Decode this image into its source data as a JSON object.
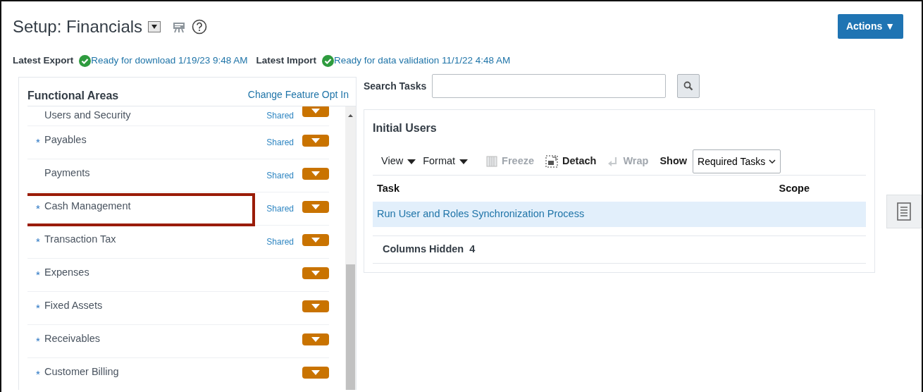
{
  "page": {
    "title": "Setup: Financials"
  },
  "actions_button": {
    "label": "Actions ▼"
  },
  "status": [
    {
      "label": "Latest Export",
      "value": "Ready for download 1/19/23 9:48 AM"
    },
    {
      "label": "Latest Import",
      "value": "Ready for data validation 11/1/22 4:48 AM"
    }
  ],
  "functional_areas": {
    "title": "Functional Areas",
    "link": "Change Feature Opt In",
    "items": [
      {
        "name": "Users and Security",
        "shared": "Shared",
        "highlighted": false
      },
      {
        "marker": "*",
        "name": "Payables",
        "shared": "Shared",
        "highlighted": false
      },
      {
        "name": "Payments",
        "shared": "Shared",
        "highlighted": false
      },
      {
        "marker": "*",
        "name": "Cash Management",
        "shared": "Shared",
        "highlighted": true
      },
      {
        "marker": "*",
        "name": "Transaction Tax",
        "shared": "Shared",
        "highlighted": false
      },
      {
        "marker": "*",
        "name": "Expenses",
        "highlighted": false
      },
      {
        "marker": "*",
        "name": "Fixed Assets",
        "highlighted": false
      },
      {
        "marker": "*",
        "name": "Receivables",
        "highlighted": false
      },
      {
        "marker": "*",
        "name": "Customer Billing",
        "highlighted": false
      }
    ]
  },
  "search": {
    "label": "Search Tasks"
  },
  "task_panel": {
    "title": "Initial Users",
    "toolbar": [
      {
        "kind": "menu",
        "label": "View",
        "disabled": false
      },
      {
        "kind": "menu",
        "label": "Format",
        "disabled": false
      },
      {
        "kind": "freeze",
        "label": "Freeze",
        "disabled": true
      },
      {
        "kind": "detach",
        "label": "Detach",
        "disabled": false
      },
      {
        "kind": "wrap",
        "label": "Wrap",
        "disabled": true
      }
    ],
    "show": {
      "label": "Show",
      "value": "Required Tasks"
    },
    "columns": [
      "Task",
      "Scope"
    ],
    "rows": [
      {
        "task": "Run User and Roles Synchronization Process",
        "selected": true
      }
    ],
    "columns_hidden": {
      "label": "Columns Hidden",
      "count": "4"
    }
  }
}
